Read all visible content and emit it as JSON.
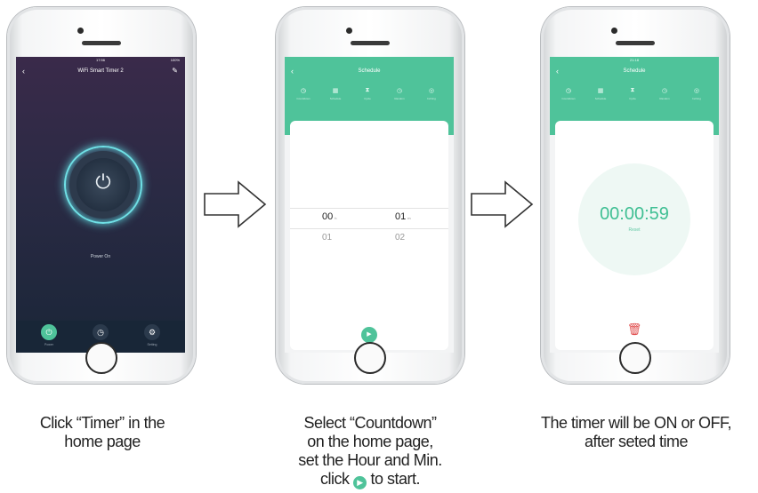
{
  "phone1": {
    "status_time": "17:56",
    "battery": "100%",
    "title": "WiFi Smart Timer 2",
    "power_text": "Power On",
    "tabs": [
      {
        "label": "Power",
        "icon": "power-icon"
      },
      {
        "label": "Timer",
        "icon": "clock-icon"
      },
      {
        "label": "Setting",
        "icon": "settings-icon"
      }
    ]
  },
  "phone2": {
    "title": "Schedule",
    "tabs": [
      "Countdown",
      "Schedule",
      "Cycle",
      "Random",
      "Inching"
    ],
    "hour_selected": "00",
    "hour_unit": "h",
    "min_selected": "01",
    "min_unit": "m",
    "hour_next": "01",
    "min_next": "02"
  },
  "phone3": {
    "status_time": "21:18",
    "title": "Schedule",
    "tabs": [
      "Countdown",
      "Schedule",
      "Cycle",
      "Random",
      "Inching"
    ],
    "countdown": "00:00:59",
    "reset": "Reset"
  },
  "captions": {
    "c1_line1": "Click “Timer” in the",
    "c1_line2": "home page",
    "c2_line1": "Select “Countdown”",
    "c2_line2": "on the home page,",
    "c2_line3": "set the Hour and Min.",
    "c2_line4a": "click",
    "c2_line4b": "to start.",
    "c3_line1": "The timer will be ON or OFF,",
    "c3_line2": "after seted time"
  },
  "colors": {
    "accent": "#4fc39a",
    "glow": "#6fe0e6",
    "danger": "#e04b4b"
  }
}
